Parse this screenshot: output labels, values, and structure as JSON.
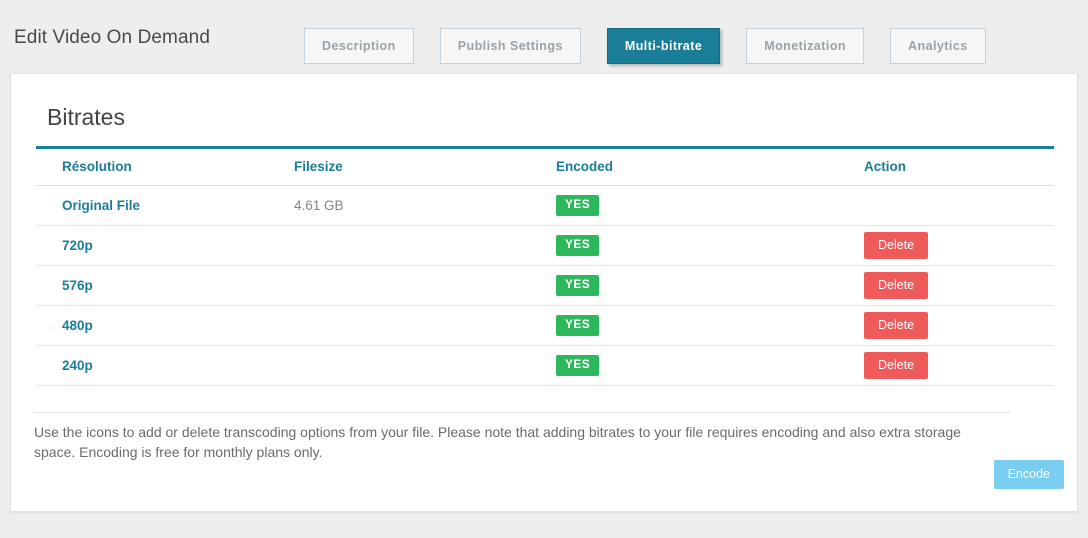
{
  "header": {
    "title": "Edit Video On Demand",
    "tabs": [
      {
        "label": "Description",
        "active": false
      },
      {
        "label": "Publish Settings",
        "active": false
      },
      {
        "label": "Multi-bitrate",
        "active": true
      },
      {
        "label": "Monetization",
        "active": false
      },
      {
        "label": "Analytics",
        "active": false
      }
    ]
  },
  "card": {
    "title": "Bitrates",
    "table": {
      "columns": [
        "Résolution",
        "Filesize",
        "Encoded",
        "Action"
      ],
      "rows": [
        {
          "resolution": "Original File",
          "filesize": "4.61 GB",
          "encoded": "YES",
          "action": ""
        },
        {
          "resolution": "720p",
          "filesize": "",
          "encoded": "YES",
          "action": "Delete"
        },
        {
          "resolution": "576p",
          "filesize": "",
          "encoded": "YES",
          "action": "Delete"
        },
        {
          "resolution": "480p",
          "filesize": "",
          "encoded": "YES",
          "action": "Delete"
        },
        {
          "resolution": "240p",
          "filesize": "",
          "encoded": "YES",
          "action": "Delete"
        }
      ]
    },
    "encode_label": "Encode",
    "helper_text": "Use the icons to add or delete transcoding options from your file. Please note that adding bitrates to your file requires encoding and also extra storage space. Encoding is free for monthly plans only."
  },
  "colors": {
    "accent_teal": "#1b7e99",
    "badge_green": "#2eb85c",
    "delete_red": "#ef5b5b",
    "encode_blue": "#78cdf0",
    "page_background": "#eeeeee",
    "card_background": "#ffffff"
  }
}
